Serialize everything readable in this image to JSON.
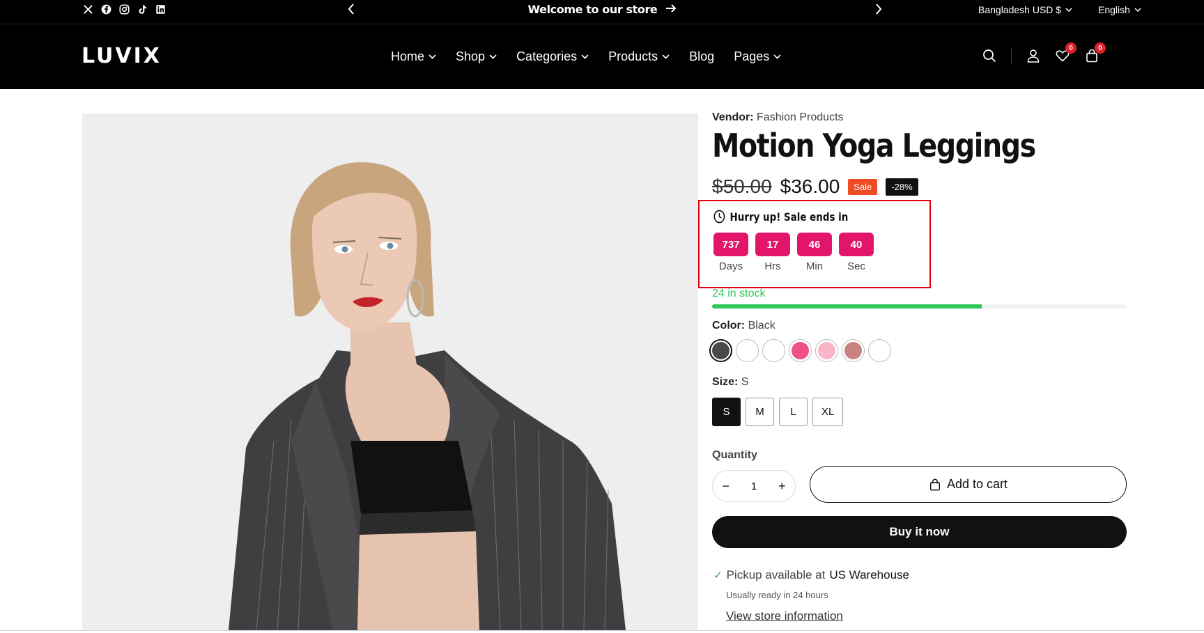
{
  "topbar": {
    "social_icons": [
      "x-icon",
      "facebook-icon",
      "instagram-icon",
      "tiktok-icon",
      "linkedin-icon"
    ],
    "announcement": "Welcome to our store",
    "currency": "Bangladesh USD $",
    "language": "English"
  },
  "header": {
    "logo": "LUVIX",
    "nav": [
      {
        "label": "Home",
        "dropdown": true
      },
      {
        "label": "Shop",
        "dropdown": true
      },
      {
        "label": "Categories",
        "dropdown": true
      },
      {
        "label": "Products",
        "dropdown": true
      },
      {
        "label": "Blog",
        "dropdown": false
      },
      {
        "label": "Pages",
        "dropdown": true
      }
    ],
    "wishlist_count": "0",
    "cart_count": "0"
  },
  "product": {
    "vendor_label": "Vendor:",
    "vendor": "Fashion Products",
    "title": "Motion Yoga Leggings",
    "compare_price": "$50.00",
    "price": "$36.00",
    "sale_badge": "Sale",
    "discount_badge": "-28%",
    "countdown": {
      "heading": "Hurry up! Sale ends in",
      "days": "737",
      "days_label": "Days",
      "hrs": "17",
      "hrs_label": "Hrs",
      "min": "46",
      "min_label": "Min",
      "sec": "40",
      "sec_label": "Sec"
    },
    "stock_text": "24 in stock",
    "stock_fraction": 0.65,
    "color_label": "Color:",
    "color_value": "Black",
    "colors": [
      "#4a4a4a",
      "#ffffff",
      "#ffffff",
      "#f0508a",
      "#f9b6c8",
      "#c98282",
      "#ffffff"
    ],
    "size_label": "Size:",
    "size_value": "S",
    "sizes": [
      "S",
      "M",
      "L",
      "XL"
    ],
    "quantity_label": "Quantity",
    "quantity": "1",
    "add_to_cart": "Add to cart",
    "buy_now": "Buy it now",
    "pickup_text": "Pickup available at",
    "pickup_location": "US Warehouse",
    "ready_text": "Usually ready in 24 hours",
    "store_link": "View store information"
  },
  "colors": {
    "accent_pink": "#e3156b",
    "sale_orange": "#f04b24",
    "stock_green": "#2fc85a",
    "highlight_red": "#e3000f"
  }
}
